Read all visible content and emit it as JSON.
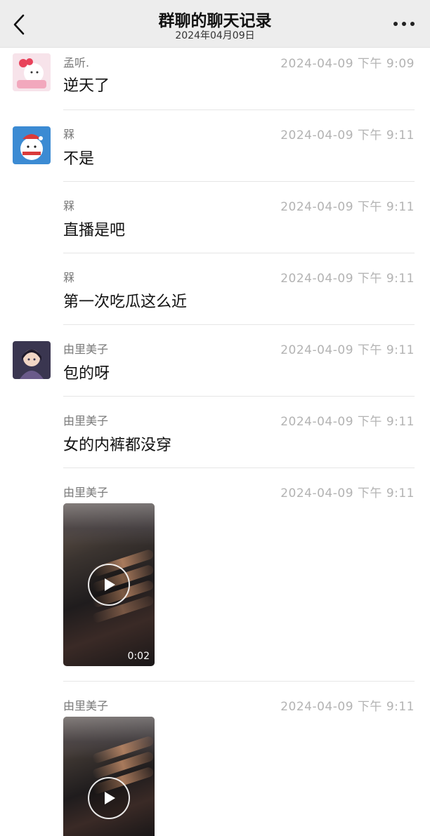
{
  "header": {
    "title": "群聊的聊天记录",
    "subtitle": "2024年04月09日"
  },
  "messages": [
    {
      "sender": "孟听.",
      "time": "2024-04-09 下午 9:09",
      "text": "逆天了"
    },
    {
      "sender": "槑",
      "time": "2024-04-09 下午 9:11",
      "text": "不是"
    },
    {
      "sender": "槑",
      "time": "2024-04-09 下午 9:11",
      "text": "直播是吧"
    },
    {
      "sender": "槑",
      "time": "2024-04-09 下午 9:11",
      "text": "第一次吃瓜这么近"
    },
    {
      "sender": "由里美子",
      "time": "2024-04-09 下午 9:11",
      "text": "包的呀"
    },
    {
      "sender": "由里美子",
      "time": "2024-04-09 下午 9:11",
      "text": "女的内裤都没穿"
    },
    {
      "sender": "由里美子",
      "time": "2024-04-09 下午 9:11",
      "video_duration": "0:02"
    },
    {
      "sender": "由里美子",
      "time": "2024-04-09 下午 9:11"
    }
  ],
  "icons": {
    "back": "chevron-left-icon",
    "more": "more-dots-icon",
    "play": "play-icon"
  },
  "colors": {
    "header_bg": "#ededed",
    "sender_text": "#7a7a7a",
    "time_text": "#b3b3b3"
  }
}
